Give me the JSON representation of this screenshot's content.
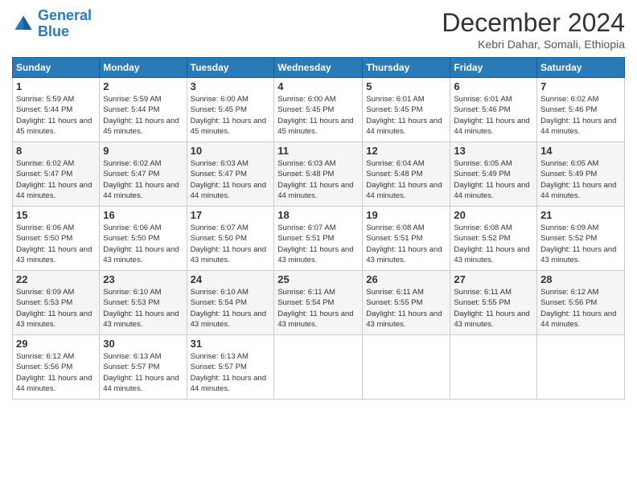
{
  "header": {
    "logo_line1": "General",
    "logo_line2": "Blue",
    "month": "December 2024",
    "location": "Kebri Dahar, Somali, Ethiopia"
  },
  "days_of_week": [
    "Sunday",
    "Monday",
    "Tuesday",
    "Wednesday",
    "Thursday",
    "Friday",
    "Saturday"
  ],
  "weeks": [
    [
      {
        "day": "1",
        "sunrise": "5:59 AM",
        "sunset": "5:44 PM",
        "daylight": "11 hours and 45 minutes."
      },
      {
        "day": "2",
        "sunrise": "5:59 AM",
        "sunset": "5:44 PM",
        "daylight": "11 hours and 45 minutes."
      },
      {
        "day": "3",
        "sunrise": "6:00 AM",
        "sunset": "5:45 PM",
        "daylight": "11 hours and 45 minutes."
      },
      {
        "day": "4",
        "sunrise": "6:00 AM",
        "sunset": "5:45 PM",
        "daylight": "11 hours and 45 minutes."
      },
      {
        "day": "5",
        "sunrise": "6:01 AM",
        "sunset": "5:45 PM",
        "daylight": "11 hours and 44 minutes."
      },
      {
        "day": "6",
        "sunrise": "6:01 AM",
        "sunset": "5:46 PM",
        "daylight": "11 hours and 44 minutes."
      },
      {
        "day": "7",
        "sunrise": "6:02 AM",
        "sunset": "5:46 PM",
        "daylight": "11 hours and 44 minutes."
      }
    ],
    [
      {
        "day": "8",
        "sunrise": "6:02 AM",
        "sunset": "5:47 PM",
        "daylight": "11 hours and 44 minutes."
      },
      {
        "day": "9",
        "sunrise": "6:02 AM",
        "sunset": "5:47 PM",
        "daylight": "11 hours and 44 minutes."
      },
      {
        "day": "10",
        "sunrise": "6:03 AM",
        "sunset": "5:47 PM",
        "daylight": "11 hours and 44 minutes."
      },
      {
        "day": "11",
        "sunrise": "6:03 AM",
        "sunset": "5:48 PM",
        "daylight": "11 hours and 44 minutes."
      },
      {
        "day": "12",
        "sunrise": "6:04 AM",
        "sunset": "5:48 PM",
        "daylight": "11 hours and 44 minutes."
      },
      {
        "day": "13",
        "sunrise": "6:05 AM",
        "sunset": "5:49 PM",
        "daylight": "11 hours and 44 minutes."
      },
      {
        "day": "14",
        "sunrise": "6:05 AM",
        "sunset": "5:49 PM",
        "daylight": "11 hours and 44 minutes."
      }
    ],
    [
      {
        "day": "15",
        "sunrise": "6:06 AM",
        "sunset": "5:50 PM",
        "daylight": "11 hours and 43 minutes."
      },
      {
        "day": "16",
        "sunrise": "6:06 AM",
        "sunset": "5:50 PM",
        "daylight": "11 hours and 43 minutes."
      },
      {
        "day": "17",
        "sunrise": "6:07 AM",
        "sunset": "5:50 PM",
        "daylight": "11 hours and 43 minutes."
      },
      {
        "day": "18",
        "sunrise": "6:07 AM",
        "sunset": "5:51 PM",
        "daylight": "11 hours and 43 minutes."
      },
      {
        "day": "19",
        "sunrise": "6:08 AM",
        "sunset": "5:51 PM",
        "daylight": "11 hours and 43 minutes."
      },
      {
        "day": "20",
        "sunrise": "6:08 AM",
        "sunset": "5:52 PM",
        "daylight": "11 hours and 43 minutes."
      },
      {
        "day": "21",
        "sunrise": "6:09 AM",
        "sunset": "5:52 PM",
        "daylight": "11 hours and 43 minutes."
      }
    ],
    [
      {
        "day": "22",
        "sunrise": "6:09 AM",
        "sunset": "5:53 PM",
        "daylight": "11 hours and 43 minutes."
      },
      {
        "day": "23",
        "sunrise": "6:10 AM",
        "sunset": "5:53 PM",
        "daylight": "11 hours and 43 minutes."
      },
      {
        "day": "24",
        "sunrise": "6:10 AM",
        "sunset": "5:54 PM",
        "daylight": "11 hours and 43 minutes."
      },
      {
        "day": "25",
        "sunrise": "6:11 AM",
        "sunset": "5:54 PM",
        "daylight": "11 hours and 43 minutes."
      },
      {
        "day": "26",
        "sunrise": "6:11 AM",
        "sunset": "5:55 PM",
        "daylight": "11 hours and 43 minutes."
      },
      {
        "day": "27",
        "sunrise": "6:11 AM",
        "sunset": "5:55 PM",
        "daylight": "11 hours and 43 minutes."
      },
      {
        "day": "28",
        "sunrise": "6:12 AM",
        "sunset": "5:56 PM",
        "daylight": "11 hours and 44 minutes."
      }
    ],
    [
      {
        "day": "29",
        "sunrise": "6:12 AM",
        "sunset": "5:56 PM",
        "daylight": "11 hours and 44 minutes."
      },
      {
        "day": "30",
        "sunrise": "6:13 AM",
        "sunset": "5:57 PM",
        "daylight": "11 hours and 44 minutes."
      },
      {
        "day": "31",
        "sunrise": "6:13 AM",
        "sunset": "5:57 PM",
        "daylight": "11 hours and 44 minutes."
      },
      null,
      null,
      null,
      null
    ]
  ]
}
